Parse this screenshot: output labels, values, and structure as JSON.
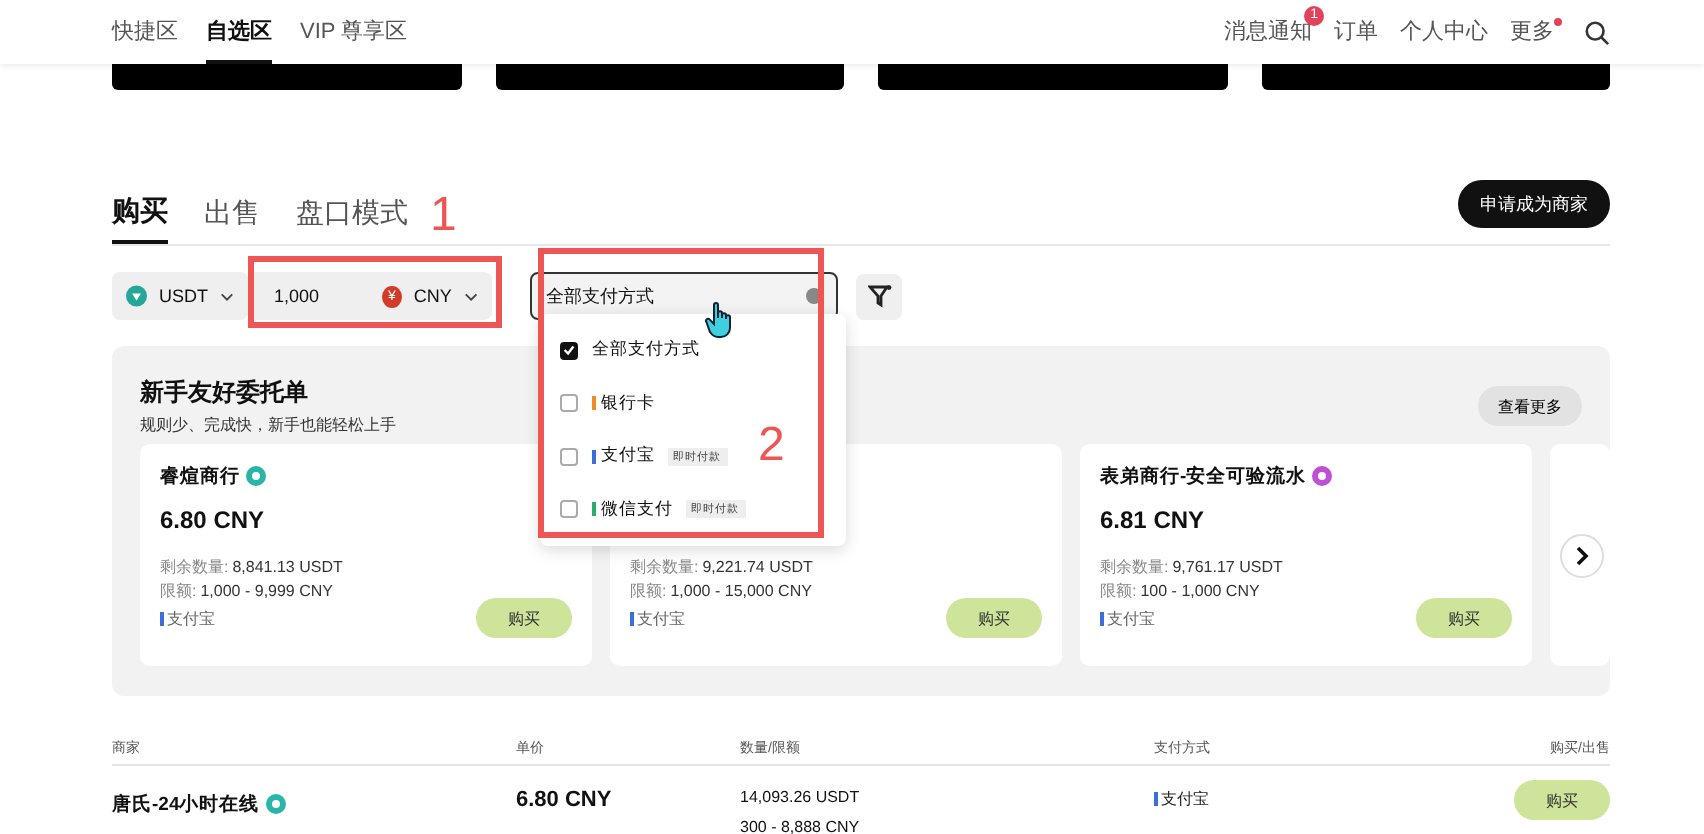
{
  "nav": {
    "left": [
      {
        "label": "快捷区",
        "selected": false
      },
      {
        "label": "自选区",
        "selected": true
      },
      {
        "label": "VIP 尊享区",
        "selected": false
      }
    ],
    "right": [
      {
        "label": "消息通知",
        "badge": "1",
        "dot": false
      },
      {
        "label": "订单",
        "dot": false
      },
      {
        "label": "个人中心",
        "dot": false
      },
      {
        "label": "更多",
        "dot": true
      }
    ]
  },
  "tabs": [
    {
      "label": "购买",
      "selected": true
    },
    {
      "label": "出售",
      "selected": false
    },
    {
      "label": "盘口模式",
      "selected": false
    }
  ],
  "apply_button": "申请成为商家",
  "filters": {
    "coin": "USDT",
    "amount": "1,000",
    "currency_symbol": "¥",
    "currency": "CNY",
    "payment": "全部支付方式"
  },
  "payment_menu": [
    {
      "label": "全部支付方式",
      "checked": true
    },
    {
      "label": "银行卡",
      "checked": false,
      "color": "#f08a24"
    },
    {
      "label": "支付宝",
      "checked": false,
      "color": "#3b6fd8",
      "tag": "即时付款"
    },
    {
      "label": "微信支付",
      "checked": false,
      "color": "#2aae67",
      "tag": "即时付款"
    }
  ],
  "promo": {
    "title": "新手友好委托单",
    "subtitle": "规则少、完成快，新手也能轻松上手",
    "more_button": "查看更多",
    "cards": [
      {
        "name": "睿煊商行",
        "color": "#2bb5a8",
        "price": "6.80 CNY",
        "remaining_label": "剩余数量:",
        "remaining": "8,841.13 USDT",
        "limit_label": "限额:",
        "limit": "1,000 - 9,999 CNY",
        "payment": "支付宝",
        "button": "购买"
      },
      {
        "remaining_label": "剩余数量:",
        "remaining": "9,221.74 USDT",
        "limit_label": "限额:",
        "limit": "1,000 - 15,000 CNY",
        "payment": "支付宝",
        "button": "购买"
      },
      {
        "name": "表弟商行-安全可验流水",
        "color": "#c04fd8",
        "price": "6.81 CNY",
        "remaining_label": "剩余数量:",
        "remaining": "9,761.17 USDT",
        "limit_label": "限额:",
        "limit": "100 - 1,000 CNY",
        "payment": "支付宝",
        "button": "购买"
      }
    ]
  },
  "table": {
    "columns": [
      "商家",
      "单价",
      "数量/限额",
      "支付方式",
      "购买/出售"
    ],
    "rows": [
      {
        "merchant": "唐氏-24小时在线",
        "color": "#2bb5a8",
        "price": "6.80 CNY",
        "quantity": "14,093.26 USDT",
        "limit": "300 - 8,888 CNY",
        "payment": "支付宝",
        "button": "购买"
      }
    ]
  },
  "annotations": [
    {
      "label": "1"
    },
    {
      "label": "2"
    }
  ]
}
